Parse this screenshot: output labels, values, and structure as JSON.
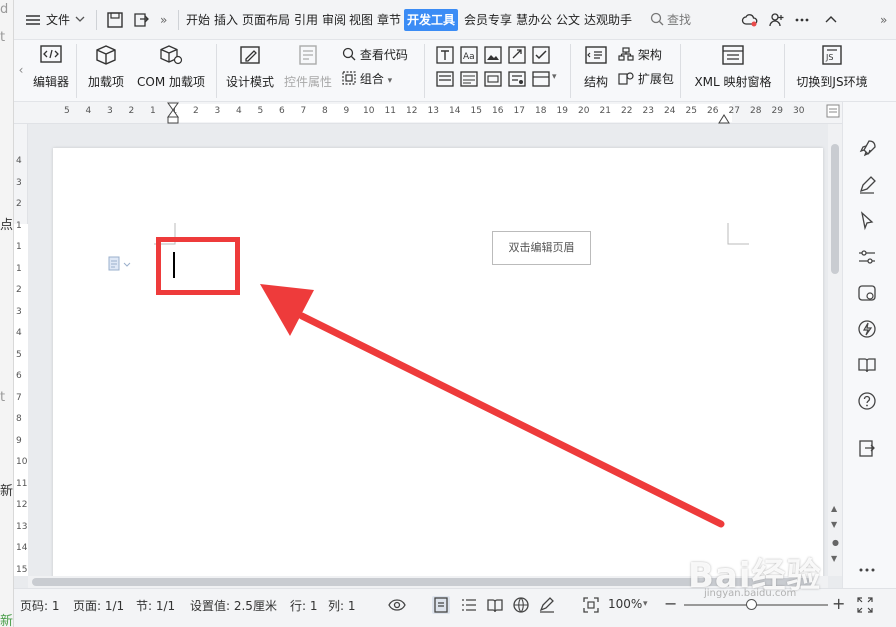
{
  "titlebar": {
    "menu_label": "文件",
    "tabs": [
      "开始",
      "插入",
      "页面布局",
      "引用",
      "审阅",
      "视图",
      "章节",
      "开发工具",
      "会员专享",
      "慧办公",
      "公文",
      "达观助手"
    ],
    "active_tab": "开发工具",
    "search_label": "查找"
  },
  "ribbon": {
    "editor": "编辑器",
    "addins": "加载项",
    "com_addins": "COM 加载项",
    "design_mode": "设计模式",
    "control_props": "控件属性",
    "view_code": "查看代码",
    "group": "组合",
    "structure": "结构",
    "schema": "架构",
    "expansion_pack": "扩展包",
    "xml_pane": "XML 映射窗格",
    "switch_js": "切换到JS环境"
  },
  "ruler": {
    "ticks": [
      "5",
      "4",
      "3",
      "2",
      "1",
      "1",
      "2",
      "3",
      "4",
      "5",
      "6",
      "7",
      "8",
      "9",
      "10",
      "11",
      "12",
      "13",
      "14",
      "15",
      "16",
      "17",
      "18",
      "19",
      "20",
      "21",
      "22",
      "23",
      "24",
      "25",
      "26",
      "27",
      "28",
      "29",
      "30"
    ],
    "vticks": [
      "4",
      "3",
      "2",
      "1",
      "1",
      "1",
      "2",
      "3",
      "4",
      "5",
      "6",
      "7",
      "8",
      "9",
      "10",
      "11",
      "12",
      "13",
      "14",
      "15"
    ]
  },
  "document": {
    "header_hint": "双击编辑页眉"
  },
  "statusbar": {
    "page_num": "页码: 1",
    "pages": "页面: 1/1",
    "section": "节: 1/1",
    "setting": "设置值: 2.5厘米",
    "row": "行: 1",
    "col": "列: 1",
    "zoom": "100%"
  },
  "bg_fragments": [
    "d",
    "t",
    "点",
    "t",
    "新",
    "新"
  ],
  "colors": {
    "accent": "#3b8cf5",
    "annotation_red": "#ee3b3b"
  },
  "watermark": {
    "main": "Bai经验",
    "sub": "jingyan.baidu.com"
  }
}
